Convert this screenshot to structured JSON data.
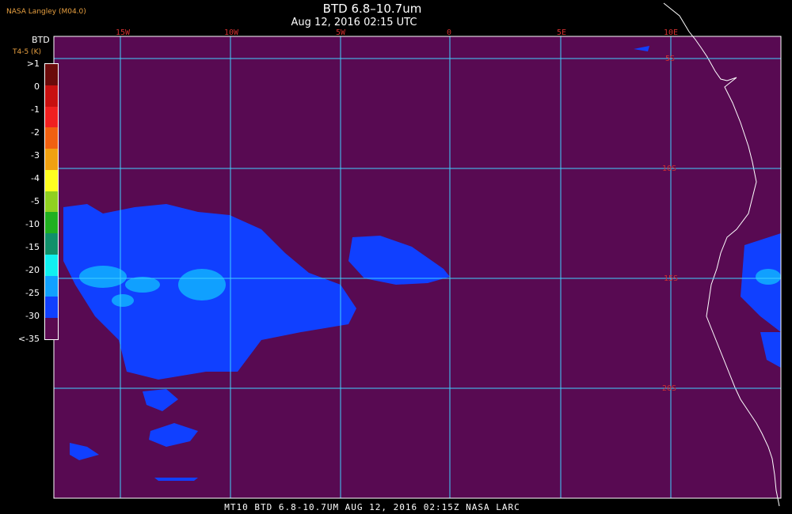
{
  "header": {
    "title": "BTD 6.8–10.7um",
    "date": "Aug 12, 2016 02:15 UTC",
    "producer": "NASA Langley (M04.0)"
  },
  "legend": {
    "title": "BTD",
    "subtitle": "T4-5 (K)",
    "labels": [
      ">1",
      "0",
      "-1",
      "-2",
      "-3",
      "-4",
      "-5",
      "-10",
      "-15",
      "-20",
      "-25",
      "-30",
      "<-35"
    ],
    "colors": [
      "#6a0a0a",
      "#c81010",
      "#f02020",
      "#f06010",
      "#f0a010",
      "#ffff20",
      "#90d020",
      "#20b020",
      "#10906a",
      "#10f0f0",
      "#10a0ff",
      "#1040ff",
      "#5a0a50"
    ]
  },
  "map": {
    "background_color": "#580a52",
    "grid_color": "#40d0ff",
    "lon_labels": [
      "15W",
      "10W",
      "5W",
      "0",
      "5E",
      "10E"
    ],
    "lat_labels": [
      "5S",
      "10S",
      "15S",
      "20S"
    ]
  },
  "footer": {
    "text": "MT10  BTD 6.8-10.7UM   AUG 12, 2016 02:15Z   NASA LARC"
  }
}
